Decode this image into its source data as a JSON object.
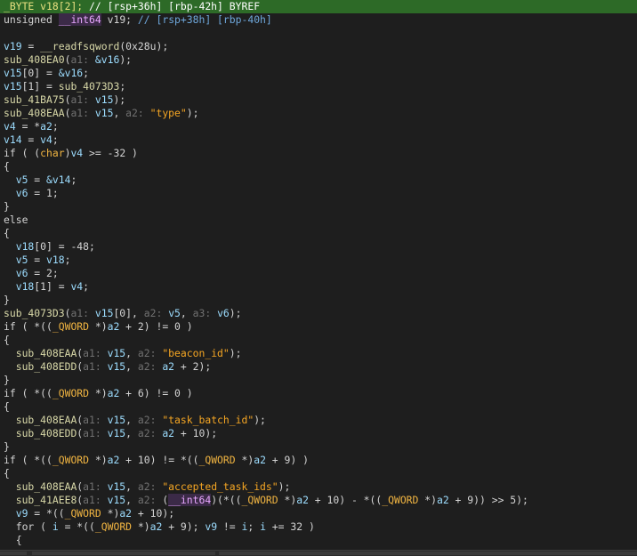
{
  "code_lines": [
    {
      "highlight": true,
      "tokens": [
        {
          "t": "_BYTE ",
          "c": "type"
        },
        {
          "t": "v18[2]; ",
          "c": "plain"
        },
        {
          "t": "// [rsp+36h] [rbp-42h] BYREF",
          "c": "comment"
        }
      ]
    },
    {
      "highlight": false,
      "tokens": [
        {
          "t": "unsigned ",
          "c": "plain"
        },
        {
          "t": "__int64",
          "c": "int64"
        },
        {
          "t": " v19; ",
          "c": "plain"
        },
        {
          "t": "// [rsp+38h] [rbp-40h]",
          "c": "comment"
        }
      ]
    },
    {
      "highlight": false,
      "tokens": []
    },
    {
      "highlight": false,
      "tokens": [
        {
          "t": "v19",
          "c": "var"
        },
        {
          "t": " = ",
          "c": "plain"
        },
        {
          "t": "__readfsqword",
          "c": "func"
        },
        {
          "t": "(0x28u);",
          "c": "plain"
        }
      ]
    },
    {
      "highlight": false,
      "tokens": [
        {
          "t": "sub_408EA0",
          "c": "func"
        },
        {
          "t": "(",
          "c": "plain"
        },
        {
          "t": "a1: ",
          "c": "hint"
        },
        {
          "t": "&v16",
          "c": "var"
        },
        {
          "t": ");",
          "c": "plain"
        }
      ]
    },
    {
      "highlight": false,
      "tokens": [
        {
          "t": "v15",
          "c": "var"
        },
        {
          "t": "[0] = ",
          "c": "plain"
        },
        {
          "t": "&v16",
          "c": "var"
        },
        {
          "t": ";",
          "c": "plain"
        }
      ]
    },
    {
      "highlight": false,
      "tokens": [
        {
          "t": "v15",
          "c": "var"
        },
        {
          "t": "[1] = ",
          "c": "plain"
        },
        {
          "t": "sub_4073D3",
          "c": "func"
        },
        {
          "t": ";",
          "c": "plain"
        }
      ]
    },
    {
      "highlight": false,
      "tokens": [
        {
          "t": "sub_41BA75",
          "c": "func"
        },
        {
          "t": "(",
          "c": "plain"
        },
        {
          "t": "a1: ",
          "c": "hint"
        },
        {
          "t": "v15",
          "c": "var"
        },
        {
          "t": ");",
          "c": "plain"
        }
      ]
    },
    {
      "highlight": false,
      "tokens": [
        {
          "t": "sub_408EAA",
          "c": "func"
        },
        {
          "t": "(",
          "c": "plain"
        },
        {
          "t": "a1: ",
          "c": "hint"
        },
        {
          "t": "v15",
          "c": "var"
        },
        {
          "t": ", ",
          "c": "plain"
        },
        {
          "t": "a2: ",
          "c": "hint"
        },
        {
          "t": "\"type\"",
          "c": "str"
        },
        {
          "t": ");",
          "c": "plain"
        }
      ]
    },
    {
      "highlight": false,
      "tokens": [
        {
          "t": "v4",
          "c": "var"
        },
        {
          "t": " = *",
          "c": "plain"
        },
        {
          "t": "a2",
          "c": "var"
        },
        {
          "t": ";",
          "c": "plain"
        }
      ]
    },
    {
      "highlight": false,
      "tokens": [
        {
          "t": "v14",
          "c": "var"
        },
        {
          "t": " = ",
          "c": "plain"
        },
        {
          "t": "v4",
          "c": "var"
        },
        {
          "t": ";",
          "c": "plain"
        }
      ]
    },
    {
      "highlight": false,
      "tokens": [
        {
          "t": "if ( (",
          "c": "kw"
        },
        {
          "t": "char",
          "c": "type"
        },
        {
          "t": ")",
          "c": "plain"
        },
        {
          "t": "v4",
          "c": "var"
        },
        {
          "t": " >= -32 )",
          "c": "plain"
        }
      ]
    },
    {
      "highlight": false,
      "tokens": [
        {
          "t": "{",
          "c": "plain"
        }
      ]
    },
    {
      "highlight": false,
      "tokens": [
        {
          "t": "  ",
          "c": "plain"
        },
        {
          "t": "v5",
          "c": "var"
        },
        {
          "t": " = ",
          "c": "plain"
        },
        {
          "t": "&v14",
          "c": "var"
        },
        {
          "t": ";",
          "c": "plain"
        }
      ]
    },
    {
      "highlight": false,
      "tokens": [
        {
          "t": "  ",
          "c": "plain"
        },
        {
          "t": "v6",
          "c": "var"
        },
        {
          "t": " = 1;",
          "c": "plain"
        }
      ]
    },
    {
      "highlight": false,
      "tokens": [
        {
          "t": "}",
          "c": "plain"
        }
      ]
    },
    {
      "highlight": false,
      "tokens": [
        {
          "t": "else",
          "c": "kw"
        }
      ]
    },
    {
      "highlight": false,
      "tokens": [
        {
          "t": "{",
          "c": "plain"
        }
      ]
    },
    {
      "highlight": false,
      "tokens": [
        {
          "t": "  ",
          "c": "plain"
        },
        {
          "t": "v18",
          "c": "var"
        },
        {
          "t": "[0] = -48;",
          "c": "plain"
        }
      ]
    },
    {
      "highlight": false,
      "tokens": [
        {
          "t": "  ",
          "c": "plain"
        },
        {
          "t": "v5",
          "c": "var"
        },
        {
          "t": " = ",
          "c": "plain"
        },
        {
          "t": "v18",
          "c": "var"
        },
        {
          "t": ";",
          "c": "plain"
        }
      ]
    },
    {
      "highlight": false,
      "tokens": [
        {
          "t": "  ",
          "c": "plain"
        },
        {
          "t": "v6",
          "c": "var"
        },
        {
          "t": " = 2;",
          "c": "plain"
        }
      ]
    },
    {
      "highlight": false,
      "tokens": [
        {
          "t": "  ",
          "c": "plain"
        },
        {
          "t": "v18",
          "c": "var"
        },
        {
          "t": "[1] = ",
          "c": "plain"
        },
        {
          "t": "v4",
          "c": "var"
        },
        {
          "t": ";",
          "c": "plain"
        }
      ]
    },
    {
      "highlight": false,
      "tokens": [
        {
          "t": "}",
          "c": "plain"
        }
      ]
    },
    {
      "highlight": false,
      "tokens": [
        {
          "t": "sub_4073D3",
          "c": "func"
        },
        {
          "t": "(",
          "c": "plain"
        },
        {
          "t": "a1: ",
          "c": "hint"
        },
        {
          "t": "v15",
          "c": "var"
        },
        {
          "t": "[0], ",
          "c": "plain"
        },
        {
          "t": "a2: ",
          "c": "hint"
        },
        {
          "t": "v5",
          "c": "var"
        },
        {
          "t": ", ",
          "c": "plain"
        },
        {
          "t": "a3: ",
          "c": "hint"
        },
        {
          "t": "v6",
          "c": "var"
        },
        {
          "t": ");",
          "c": "plain"
        }
      ]
    },
    {
      "highlight": false,
      "tokens": [
        {
          "t": "if ( *((",
          "c": "kw"
        },
        {
          "t": "_QWORD",
          "c": "type"
        },
        {
          "t": " *)",
          "c": "plain"
        },
        {
          "t": "a2",
          "c": "var"
        },
        {
          "t": " + 2) != 0 )",
          "c": "plain"
        }
      ]
    },
    {
      "highlight": false,
      "tokens": [
        {
          "t": "{",
          "c": "plain"
        }
      ]
    },
    {
      "highlight": false,
      "tokens": [
        {
          "t": "  ",
          "c": "plain"
        },
        {
          "t": "sub_408EAA",
          "c": "func"
        },
        {
          "t": "(",
          "c": "plain"
        },
        {
          "t": "a1: ",
          "c": "hint"
        },
        {
          "t": "v15",
          "c": "var"
        },
        {
          "t": ", ",
          "c": "plain"
        },
        {
          "t": "a2: ",
          "c": "hint"
        },
        {
          "t": "\"beacon_id\"",
          "c": "str"
        },
        {
          "t": ");",
          "c": "plain"
        }
      ]
    },
    {
      "highlight": false,
      "tokens": [
        {
          "t": "  ",
          "c": "plain"
        },
        {
          "t": "sub_408EDD",
          "c": "func"
        },
        {
          "t": "(",
          "c": "plain"
        },
        {
          "t": "a1: ",
          "c": "hint"
        },
        {
          "t": "v15",
          "c": "var"
        },
        {
          "t": ", ",
          "c": "plain"
        },
        {
          "t": "a2: ",
          "c": "hint"
        },
        {
          "t": "a2",
          "c": "var"
        },
        {
          "t": " + 2);",
          "c": "plain"
        }
      ]
    },
    {
      "highlight": false,
      "tokens": [
        {
          "t": "}",
          "c": "plain"
        }
      ]
    },
    {
      "highlight": false,
      "tokens": [
        {
          "t": "if ( *((",
          "c": "kw"
        },
        {
          "t": "_QWORD",
          "c": "type"
        },
        {
          "t": " *)",
          "c": "plain"
        },
        {
          "t": "a2",
          "c": "var"
        },
        {
          "t": " + 6) != 0 )",
          "c": "plain"
        }
      ]
    },
    {
      "highlight": false,
      "tokens": [
        {
          "t": "{",
          "c": "plain"
        }
      ]
    },
    {
      "highlight": false,
      "tokens": [
        {
          "t": "  ",
          "c": "plain"
        },
        {
          "t": "sub_408EAA",
          "c": "func"
        },
        {
          "t": "(",
          "c": "plain"
        },
        {
          "t": "a1: ",
          "c": "hint"
        },
        {
          "t": "v15",
          "c": "var"
        },
        {
          "t": ", ",
          "c": "plain"
        },
        {
          "t": "a2: ",
          "c": "hint"
        },
        {
          "t": "\"task_batch_id\"",
          "c": "str"
        },
        {
          "t": ");",
          "c": "plain"
        }
      ]
    },
    {
      "highlight": false,
      "tokens": [
        {
          "t": "  ",
          "c": "plain"
        },
        {
          "t": "sub_408EDD",
          "c": "func"
        },
        {
          "t": "(",
          "c": "plain"
        },
        {
          "t": "a1: ",
          "c": "hint"
        },
        {
          "t": "v15",
          "c": "var"
        },
        {
          "t": ", ",
          "c": "plain"
        },
        {
          "t": "a2: ",
          "c": "hint"
        },
        {
          "t": "a2",
          "c": "var"
        },
        {
          "t": " + 10);",
          "c": "plain"
        }
      ]
    },
    {
      "highlight": false,
      "tokens": [
        {
          "t": "}",
          "c": "plain"
        }
      ]
    },
    {
      "highlight": false,
      "tokens": [
        {
          "t": "if ( *((",
          "c": "kw"
        },
        {
          "t": "_QWORD",
          "c": "type"
        },
        {
          "t": " *)",
          "c": "plain"
        },
        {
          "t": "a2",
          "c": "var"
        },
        {
          "t": " + 10) != *((",
          "c": "plain"
        },
        {
          "t": "_QWORD",
          "c": "type"
        },
        {
          "t": " *)",
          "c": "plain"
        },
        {
          "t": "a2",
          "c": "var"
        },
        {
          "t": " + 9) )",
          "c": "plain"
        }
      ]
    },
    {
      "highlight": false,
      "tokens": [
        {
          "t": "{",
          "c": "plain"
        }
      ]
    },
    {
      "highlight": false,
      "tokens": [
        {
          "t": "  ",
          "c": "plain"
        },
        {
          "t": "sub_408EAA",
          "c": "func"
        },
        {
          "t": "(",
          "c": "plain"
        },
        {
          "t": "a1: ",
          "c": "hint"
        },
        {
          "t": "v15",
          "c": "var"
        },
        {
          "t": ", ",
          "c": "plain"
        },
        {
          "t": "a2: ",
          "c": "hint"
        },
        {
          "t": "\"accepted_task_ids\"",
          "c": "str"
        },
        {
          "t": ");",
          "c": "plain"
        }
      ]
    },
    {
      "highlight": false,
      "tokens": [
        {
          "t": "  ",
          "c": "plain"
        },
        {
          "t": "sub_41AEE8",
          "c": "func"
        },
        {
          "t": "(",
          "c": "plain"
        },
        {
          "t": "a1: ",
          "c": "hint"
        },
        {
          "t": "v15",
          "c": "var"
        },
        {
          "t": ", ",
          "c": "plain"
        },
        {
          "t": "a2: ",
          "c": "hint"
        },
        {
          "t": "(",
          "c": "plain"
        },
        {
          "t": "__int64",
          "c": "int64"
        },
        {
          "t": ")(*((",
          "c": "plain"
        },
        {
          "t": "_QWORD",
          "c": "type"
        },
        {
          "t": " *)",
          "c": "plain"
        },
        {
          "t": "a2",
          "c": "var"
        },
        {
          "t": " + 10) - *((",
          "c": "plain"
        },
        {
          "t": "_QWORD",
          "c": "type"
        },
        {
          "t": " *)",
          "c": "plain"
        },
        {
          "t": "a2",
          "c": "var"
        },
        {
          "t": " + 9)) >> 5);",
          "c": "plain"
        }
      ]
    },
    {
      "highlight": false,
      "tokens": [
        {
          "t": "  ",
          "c": "plain"
        },
        {
          "t": "v9",
          "c": "var"
        },
        {
          "t": " = *((",
          "c": "plain"
        },
        {
          "t": "_QWORD",
          "c": "type"
        },
        {
          "t": " *)",
          "c": "plain"
        },
        {
          "t": "a2",
          "c": "var"
        },
        {
          "t": " + 10);",
          "c": "plain"
        }
      ]
    },
    {
      "highlight": false,
      "tokens": [
        {
          "t": "  for ( ",
          "c": "kw"
        },
        {
          "t": "i",
          "c": "var"
        },
        {
          "t": " = *((",
          "c": "plain"
        },
        {
          "t": "_QWORD",
          "c": "type"
        },
        {
          "t": " *)",
          "c": "plain"
        },
        {
          "t": "a2",
          "c": "var"
        },
        {
          "t": " + 9); ",
          "c": "plain"
        },
        {
          "t": "v9",
          "c": "var"
        },
        {
          "t": " != ",
          "c": "plain"
        },
        {
          "t": "i",
          "c": "var"
        },
        {
          "t": "; ",
          "c": "plain"
        },
        {
          "t": "i",
          "c": "var"
        },
        {
          "t": " += 32 )",
          "c": "plain"
        }
      ]
    },
    {
      "highlight": false,
      "tokens": [
        {
          "t": "  {",
          "c": "plain"
        }
      ]
    }
  ],
  "colors": {
    "background": "#1e1e1e",
    "highlight_line": "#2d6a27",
    "variable": "#9cdcfe",
    "function": "#d8d8a8",
    "string": "#f5a623",
    "type": "#f0b441",
    "hint": "#707070",
    "comment": "#6fa8dc"
  }
}
